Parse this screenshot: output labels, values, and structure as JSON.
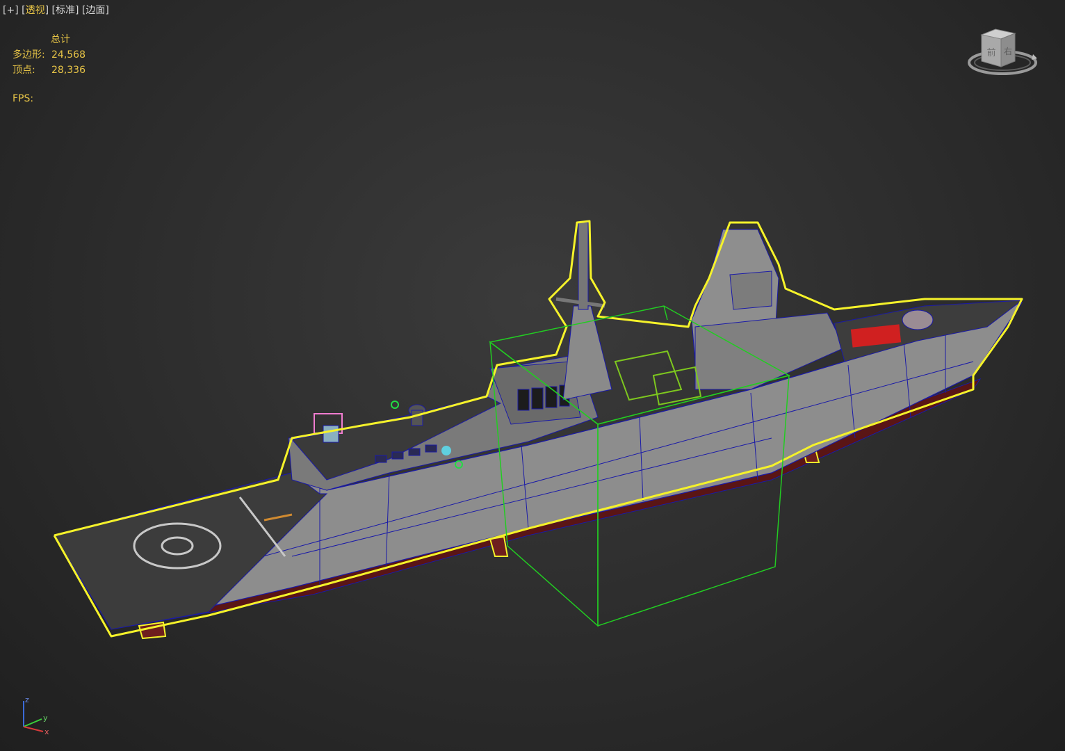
{
  "viewport": {
    "labels": {
      "plus": "[+]",
      "view": "透视",
      "shading": "标准",
      "edges": "边面"
    },
    "stats": {
      "header": "总计",
      "polys_label": "多边形:",
      "polys_value": "24,568",
      "verts_label": "顶点:",
      "verts_value": "28,336",
      "fps_label": "FPS:"
    },
    "viewcube": {
      "icon": "viewcube-icon",
      "face_left": "前",
      "face_right": "右"
    },
    "axis": {
      "x": "x",
      "y": "y",
      "z": "z"
    }
  },
  "colors": {
    "background": "#2f2f2f",
    "label_active": "#e8c547",
    "selection_outline": "#f5f22a",
    "wireframe": "#1a1aa8",
    "gizmo_box": "#22cc22",
    "hull": "#8f8f8f",
    "hull_lower": "#6b1a1a"
  }
}
